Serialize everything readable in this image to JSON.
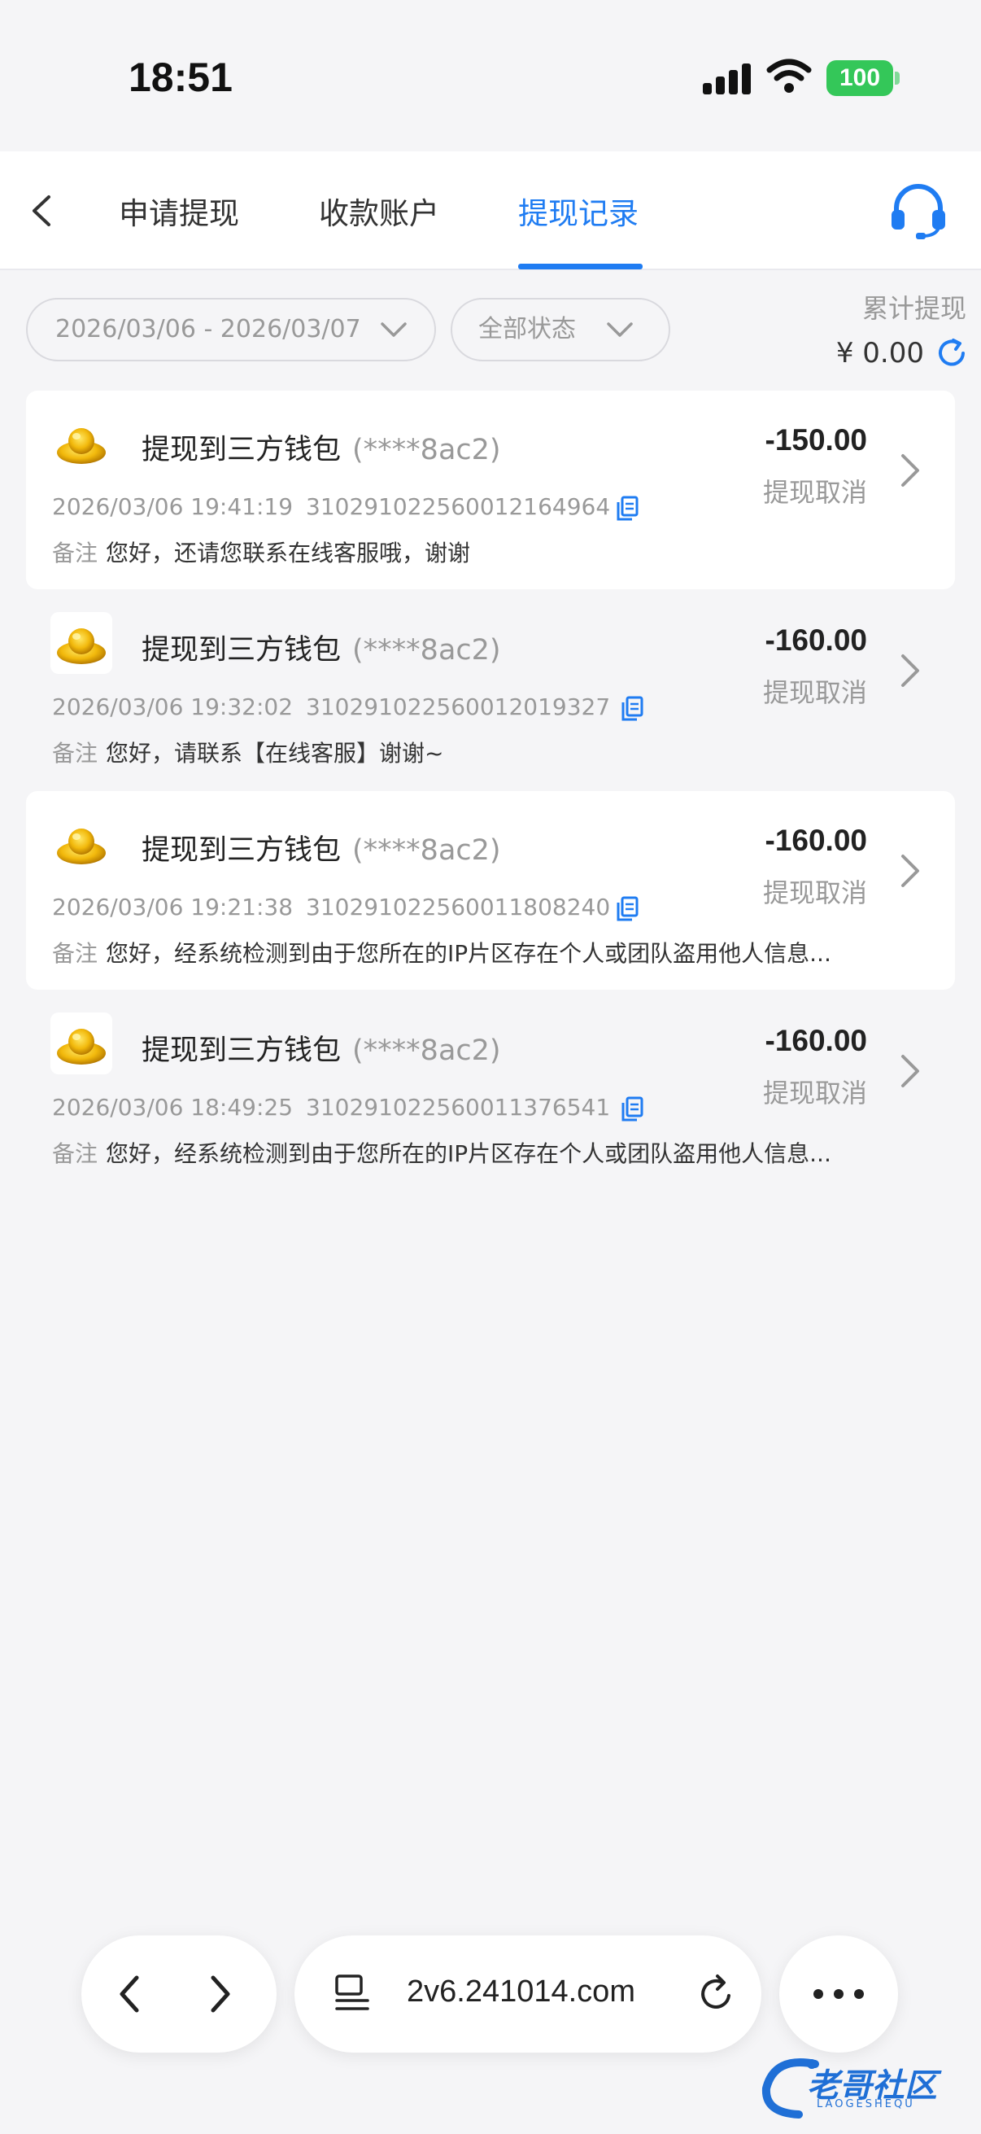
{
  "status_bar": {
    "time": "18:51",
    "battery": "100"
  },
  "nav": {
    "tabs": [
      {
        "label": "申请提现"
      },
      {
        "label": "收款账户"
      },
      {
        "label": "提现记录"
      }
    ]
  },
  "filters": {
    "date_range": "2026/03/06 - 2026/03/07",
    "status": "全部状态"
  },
  "summary": {
    "total_label": "累计提现",
    "total_value": "¥ 0.00"
  },
  "records": [
    {
      "title": "提现到三方钱包",
      "account": "(****8ac2)",
      "amount": "-150.00",
      "status": "提现取消",
      "datetime": "2026/03/06 19:41:19",
      "order_id": "310291022560012164964",
      "remark_label": "备注",
      "remark": "您好，还请您联系在线客服哦，谢谢"
    },
    {
      "title": "提现到三方钱包",
      "account": "(****8ac2)",
      "amount": "-160.00",
      "status": "提现取消",
      "datetime": "2026/03/06 19:32:02",
      "order_id": "310291022560012019327",
      "remark_label": "备注",
      "remark": "您好，请联系【在线客服】谢谢~"
    },
    {
      "title": "提现到三方钱包",
      "account": "(****8ac2)",
      "amount": "-160.00",
      "status": "提现取消",
      "datetime": "2026/03/06 19:21:38",
      "order_id": "310291022560011808240",
      "remark_label": "备注",
      "remark": "您好，经系统检测到由于您所在的IP片区存在个人或团队盗用他人信息..."
    },
    {
      "title": "提现到三方钱包",
      "account": "(****8ac2)",
      "amount": "-160.00",
      "status": "提现取消",
      "datetime": "2026/03/06 18:49:25",
      "order_id": "310291022560011376541",
      "remark_label": "备注",
      "remark": "您好，经系统检测到由于您所在的IP片区存在个人或团队盗用他人信息..."
    }
  ],
  "browser": {
    "url": "2v6.241014.com"
  },
  "watermark": {
    "text": "老哥社区",
    "sub": "LAOGESHEQU"
  },
  "colors": {
    "accent": "#1f7cf2",
    "battery": "#34c759"
  },
  "icons": [
    "back-icon",
    "support-headset-icon",
    "chevron-down-icon",
    "refresh-icon",
    "gold-ingot-icon",
    "copy-icon",
    "chevron-right-icon",
    "browser-back-icon",
    "browser-forward-icon",
    "tabs-icon",
    "reload-icon",
    "more-icon"
  ]
}
